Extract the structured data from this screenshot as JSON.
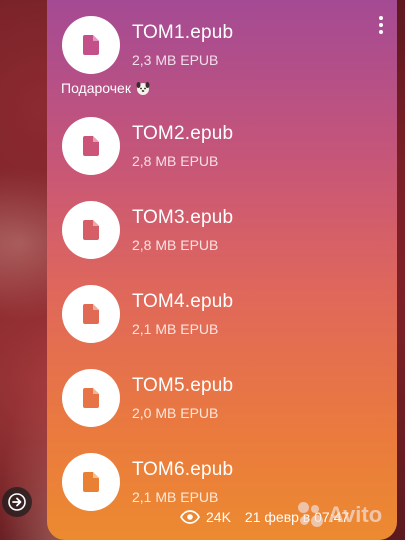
{
  "message": {
    "files": [
      {
        "name": "ТОМ1.epub",
        "meta": "2,3 MB EPUB"
      },
      {
        "name": "ТОМ2.epub",
        "meta": "2,8 MB EPUB"
      },
      {
        "name": "ТОМ3.epub",
        "meta": "2,8 MB EPUB"
      },
      {
        "name": "ТОМ4.epub",
        "meta": "2,1 MB EPUB"
      },
      {
        "name": "ТОМ5.epub",
        "meta": "2,0 MB EPUB"
      },
      {
        "name": "ТОМ6.epub",
        "meta": "2,1 MB EPUB"
      }
    ],
    "caption": "Подарочек",
    "views": "24K",
    "date": "21 февр в 07:47"
  },
  "watermark": {
    "text": "Avito"
  },
  "icons": {
    "file": "document-icon",
    "menu": "more-vertical-icon",
    "views": "eye-icon",
    "forward": "forward-arrow-icon",
    "sticker": "dog-emoji-icon"
  },
  "colors": {
    "bubble_top": "#a44a94",
    "bubble_mid": "#e0685a",
    "bubble_bottom": "#ec8a30",
    "icon_bg": "#ffffff",
    "text": "#ffffff"
  }
}
